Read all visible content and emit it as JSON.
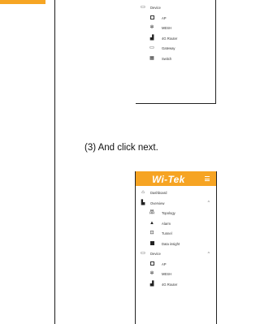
{
  "caption": "(3)  And click next.",
  "app": {
    "logo": "Wi-Tek"
  },
  "shot1": {
    "section": {
      "label": "Device",
      "icon": "monitor-icon"
    },
    "items": [
      {
        "label": "AP",
        "icon": "ap-icon"
      },
      {
        "label": "MESH",
        "icon": "mesh-icon"
      },
      {
        "label": "4G Router",
        "icon": "router-icon"
      },
      {
        "label": "Gateway",
        "icon": "gateway-icon"
      },
      {
        "label": "Switch",
        "icon": "switch-icon"
      }
    ]
  },
  "shot2": {
    "dashboard": {
      "label": "Dashboard",
      "icon": "home-icon"
    },
    "overview": {
      "label": "Overview",
      "icon": "overview-icon",
      "expanded_chevron": "^",
      "items": [
        {
          "label": "Topology",
          "icon": "topology-icon"
        },
        {
          "label": "Alarm",
          "icon": "bell-icon"
        },
        {
          "label": "Tunnel",
          "icon": "tunnel-icon"
        },
        {
          "label": "Data insight",
          "icon": "data-insight-icon"
        }
      ]
    },
    "device": {
      "label": "Device",
      "icon": "monitor-icon",
      "expanded_chevron": "^",
      "items": [
        {
          "label": "AP",
          "icon": "ap-icon"
        },
        {
          "label": "MESH",
          "icon": "mesh-icon"
        },
        {
          "label": "4G Router",
          "icon": "router-icon"
        }
      ]
    }
  }
}
